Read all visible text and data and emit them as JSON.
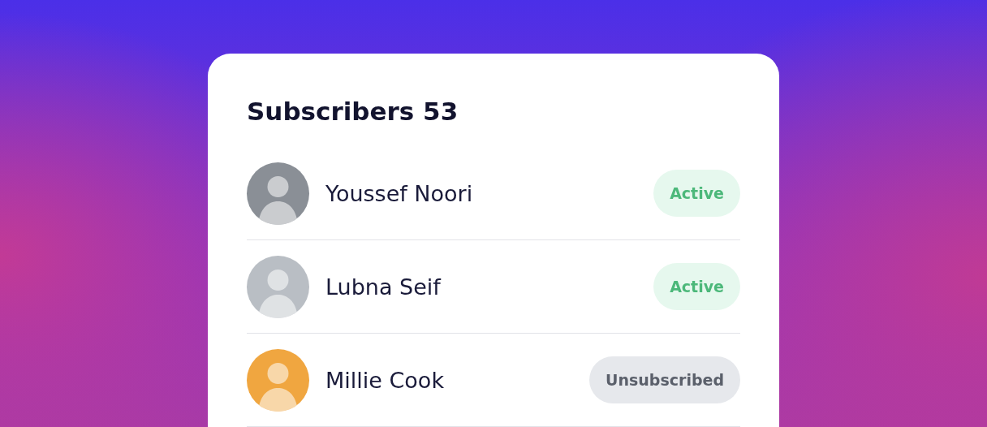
{
  "title": "Subscribers 53",
  "subscribers": [
    {
      "name": "Youssef Noori",
      "color": "#8a8f96",
      "status": {
        "label": "Active",
        "kind": "active"
      }
    },
    {
      "name": "Lubna Seif",
      "color": "#b9bec4",
      "status": {
        "label": "Active",
        "kind": "active"
      }
    },
    {
      "name": "Millie Cook",
      "color": "#f0a640",
      "status": {
        "label": "Unsubscribed",
        "kind": "unsubscribed"
      }
    }
  ]
}
